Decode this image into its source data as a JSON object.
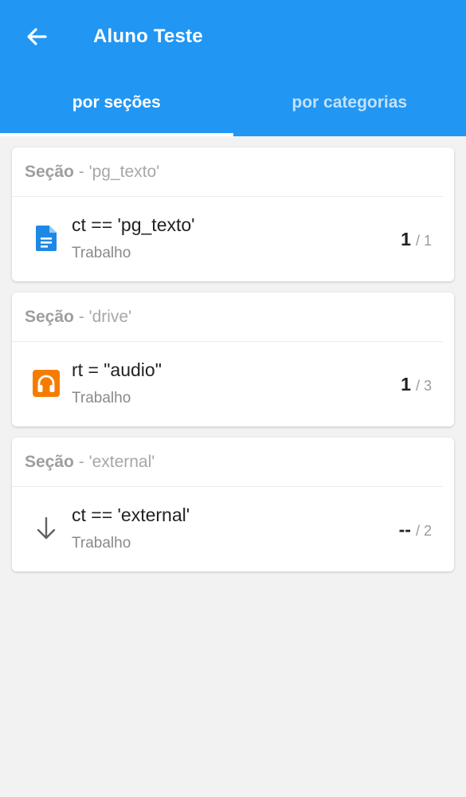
{
  "header": {
    "title": "Aluno Teste",
    "back_icon": "arrow-left-icon",
    "background": "#2196f3"
  },
  "tabs": [
    {
      "label": "por seções",
      "active": true
    },
    {
      "label": "por categorias",
      "active": false
    }
  ],
  "sections": [
    {
      "label": "Seção",
      "dash": "-",
      "name": "'pg_texto'",
      "item": {
        "icon": "document-icon",
        "icon_color": "#1e88e5",
        "title": "ct == 'pg_texto'",
        "subtitle": "Trabalho",
        "score": "1",
        "separator": "/",
        "total": "1"
      }
    },
    {
      "label": "Seção",
      "dash": "-",
      "name": "'drive'",
      "item": {
        "icon": "headphones-icon",
        "icon_color": "#f57c00",
        "title": "rt = \"audio\"",
        "subtitle": "Trabalho",
        "score": "1",
        "separator": "/",
        "total": "3"
      }
    },
    {
      "label": "Seção",
      "dash": "-",
      "name": "'external'",
      "item": {
        "icon": "arrow-down-icon",
        "icon_color": "#616161",
        "title": "ct == 'external'",
        "subtitle": "Trabalho",
        "score": "--",
        "separator": "/",
        "total": "2"
      }
    }
  ]
}
